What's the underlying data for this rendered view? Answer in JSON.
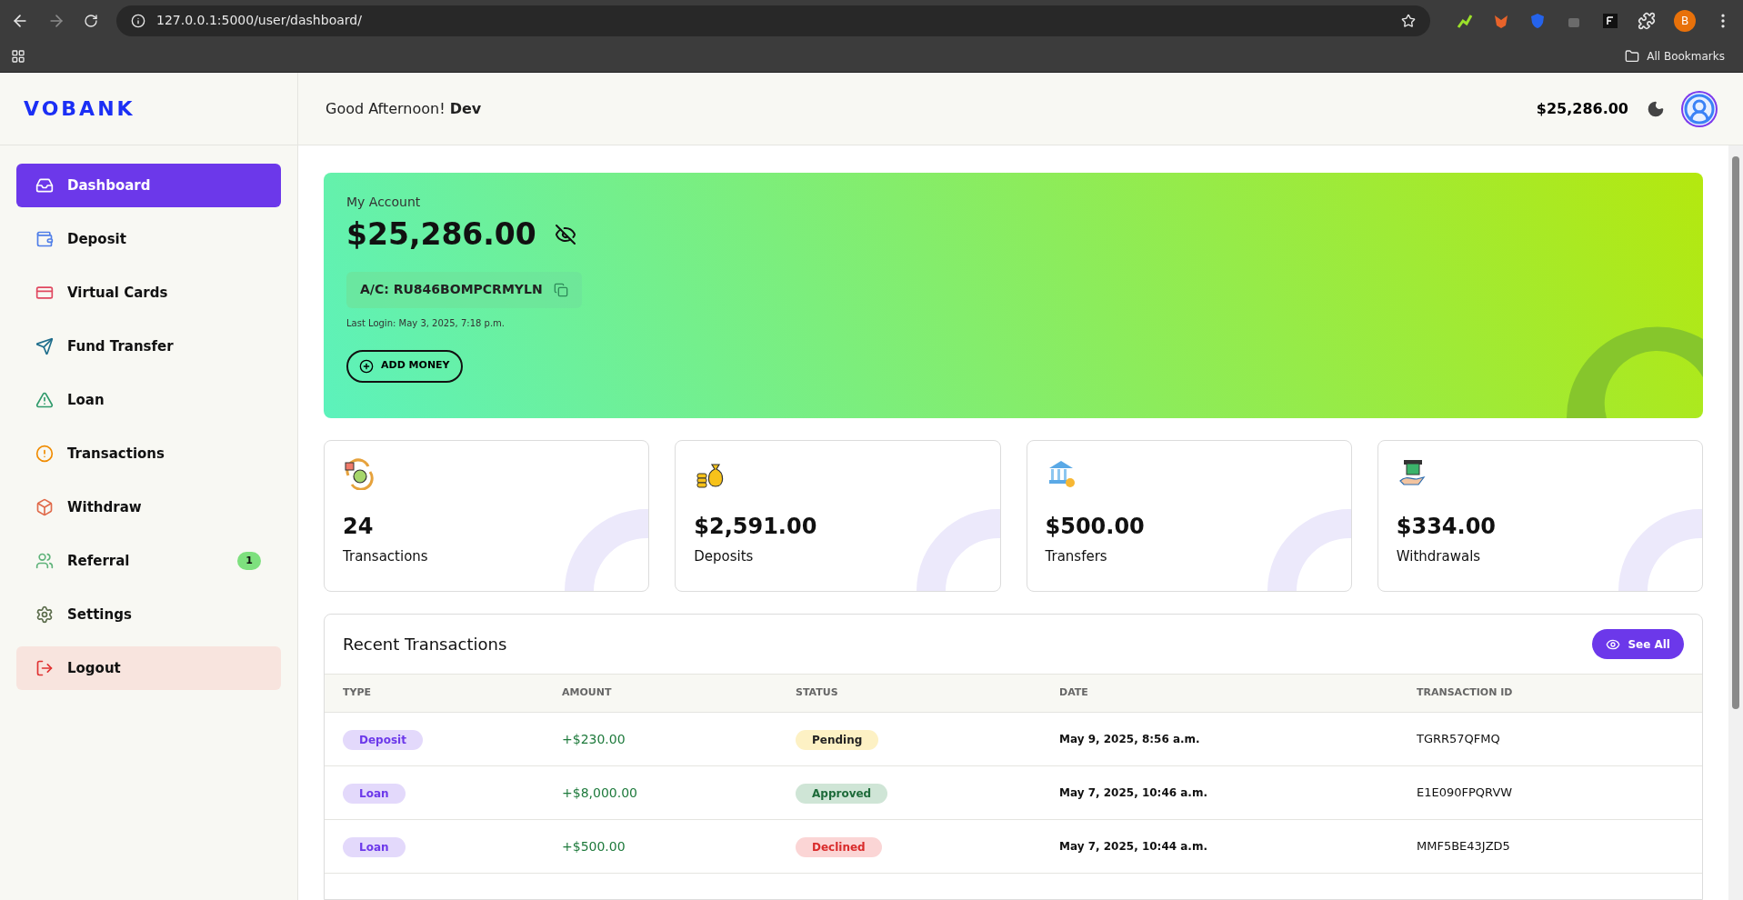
{
  "browser": {
    "url": "127.0.0.1:5000/user/dashboard/",
    "profile_initial": "B",
    "bookmarks_label": "All Bookmarks"
  },
  "brand": "VOBANK",
  "sidebar": {
    "items": [
      {
        "label": "Dashboard",
        "kind": "link",
        "selected": true,
        "color": "#ffffff"
      },
      {
        "label": "Deposit",
        "kind": "link",
        "selected": false,
        "color": "#4f7ee8"
      },
      {
        "label": "Virtual Cards",
        "kind": "link",
        "selected": false,
        "color": "#e0475f"
      },
      {
        "label": "Fund Transfer",
        "kind": "link",
        "selected": false,
        "color": "#1f6e8c"
      },
      {
        "label": "Loan",
        "kind": "link",
        "selected": false,
        "color": "#2f9a6b"
      },
      {
        "label": "Transactions",
        "kind": "link",
        "selected": false,
        "color": "#f08c00"
      },
      {
        "label": "Withdraw",
        "kind": "link",
        "selected": false,
        "color": "#e06a4a"
      },
      {
        "label": "Referral",
        "kind": "link",
        "selected": false,
        "color": "#5fb37a",
        "badge": "1"
      },
      {
        "label": "Settings",
        "kind": "link",
        "selected": false,
        "color": "#5a6b4a"
      },
      {
        "label": "Logout",
        "kind": "logout",
        "selected": false,
        "color": "#e03131"
      }
    ]
  },
  "header": {
    "greeting": "Good Afternoon!",
    "user": "Dev",
    "balance": "$25,286.00"
  },
  "account": {
    "label": "My Account",
    "balance": "$25,286.00",
    "account_number": "A/C: RU846BOMPCRMYLN",
    "last_login": "Last Login: May 3, 2025, 7:18 p.m.",
    "add_money": "ADD MONEY"
  },
  "stats": [
    {
      "value": "24",
      "label": "Transactions"
    },
    {
      "value": "$2,591.00",
      "label": "Deposits"
    },
    {
      "value": "$500.00",
      "label": "Transfers"
    },
    {
      "value": "$334.00",
      "label": "Withdrawals"
    }
  ],
  "recent": {
    "title": "Recent Transactions",
    "see_all": "See All",
    "columns": [
      "TYPE",
      "AMOUNT",
      "STATUS",
      "DATE",
      "TRANSACTION ID"
    ],
    "rows": [
      {
        "type": "Deposit",
        "amount": "+$230.00",
        "status": "Pending",
        "color": "#fdf1c4",
        "date": "May 9, 2025, 8:56 a.m.",
        "id": "TGRR57QFMQ"
      },
      {
        "type": "Loan",
        "amount": "+$8,000.00",
        "status": "Approved",
        "color": "#cfe5d6",
        "date": "May 7, 2025, 10:46 a.m.",
        "id": "E1E090FPQRVW"
      },
      {
        "type": "Loan",
        "amount": "+$500.00",
        "status": "Declined",
        "color": "#fbd5d5",
        "date": "May 7, 2025, 10:44 a.m.",
        "id": "MMF5BE43JZD5"
      }
    ]
  }
}
